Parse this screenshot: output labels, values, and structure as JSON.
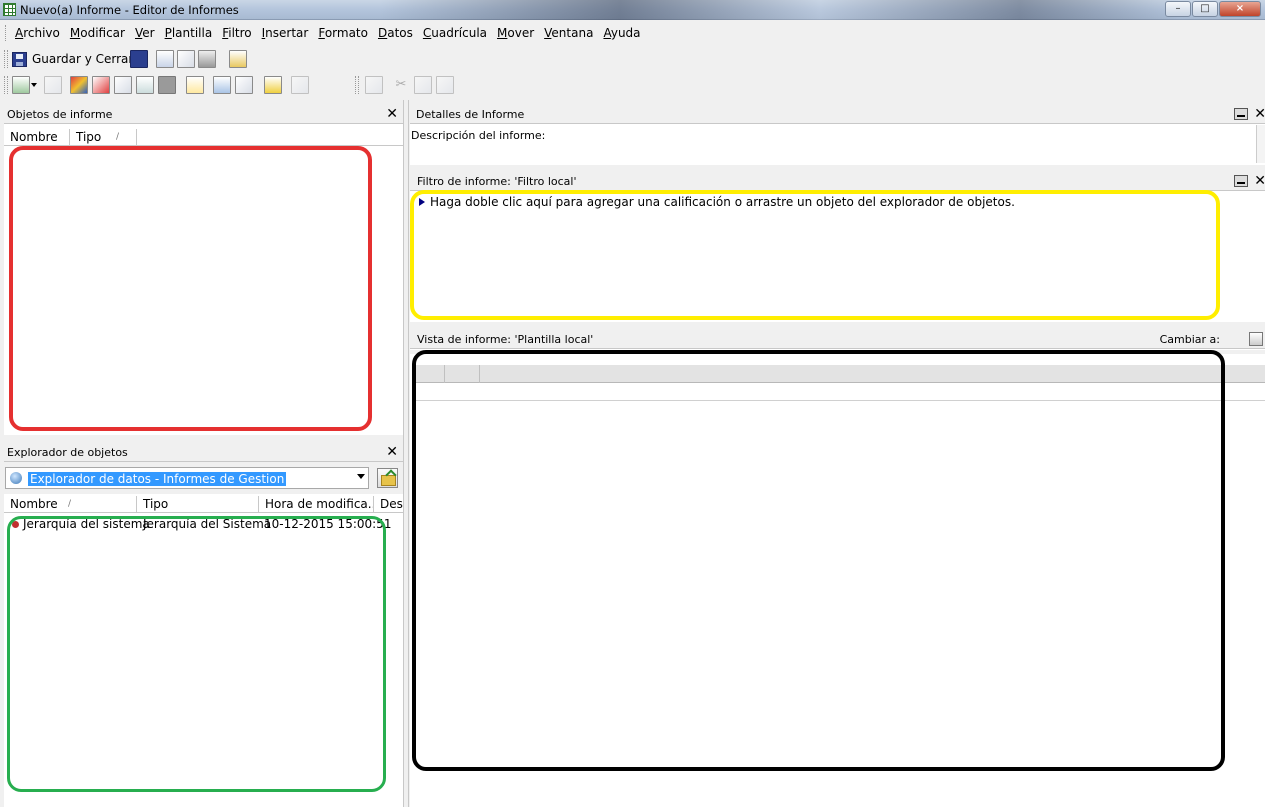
{
  "window": {
    "title": "Nuevo(a) Informe - Editor de Informes",
    "controls": {
      "minimize": "–",
      "maximize": "□",
      "close": "×"
    }
  },
  "menu": [
    {
      "label": "Archivo",
      "accel": "A",
      "rest": "rchivo"
    },
    {
      "label": "Modificar",
      "accel": "M",
      "rest": "odificar"
    },
    {
      "label": "Ver",
      "accel": "V",
      "rest": "er"
    },
    {
      "label": "Plantilla",
      "accel": "P",
      "rest": "lantilla"
    },
    {
      "label": "Filtro",
      "accel": "F",
      "rest": "iltro"
    },
    {
      "label": "Insertar",
      "accel": "I",
      "rest": "nsertar"
    },
    {
      "label": "Formato",
      "accel": "F",
      "rest": "ormato"
    },
    {
      "label": "Datos",
      "accel": "D",
      "rest": "atos"
    },
    {
      "label": "Cuadrícula",
      "accel": "C",
      "rest": "uadrícula"
    },
    {
      "label": "Mover",
      "accel": "M",
      "rest": "over"
    },
    {
      "label": "Ventana",
      "accel": "V",
      "rest": "entana"
    },
    {
      "label": "Ayuda",
      "accel": "A",
      "rest": "yuda"
    }
  ],
  "toolbar": {
    "save_close_label": "Guardar y Cerrar"
  },
  "report_objects": {
    "title": "Objetos de informe",
    "columns": [
      "Nombre",
      "Tipo"
    ],
    "sort_indicator": "/"
  },
  "object_explorer": {
    "title": "Explorador de objetos",
    "source": "Explorador de datos - Informes de Gestion",
    "columns": [
      "Nombre",
      "Tipo",
      "Hora de modifica...",
      "Desc"
    ],
    "sort_indicator": "/",
    "rows": [
      {
        "name": "Jerarquía del sistema",
        "type": "Jerarquía del Sistema",
        "modified": "10-12-2015 15:00:51",
        "desc": ""
      }
    ]
  },
  "report_details": {
    "title": "Detalles de Informe",
    "description_label": "Descripción del informe:"
  },
  "report_filter": {
    "title": "Filtro de informe: 'Filtro local'",
    "hint": "Haga doble clic aquí para agregar una calificación o arrastre un objeto del explorador de objetos."
  },
  "report_view": {
    "title": "Vista de informe: 'Plantilla local'",
    "switch_label": "Cambiar a:"
  },
  "annotations": {
    "report_objects_color": "#e53030",
    "object_explorer_color": "#27ae4f",
    "filter_color": "#ffee00",
    "view_color": "#000000"
  }
}
